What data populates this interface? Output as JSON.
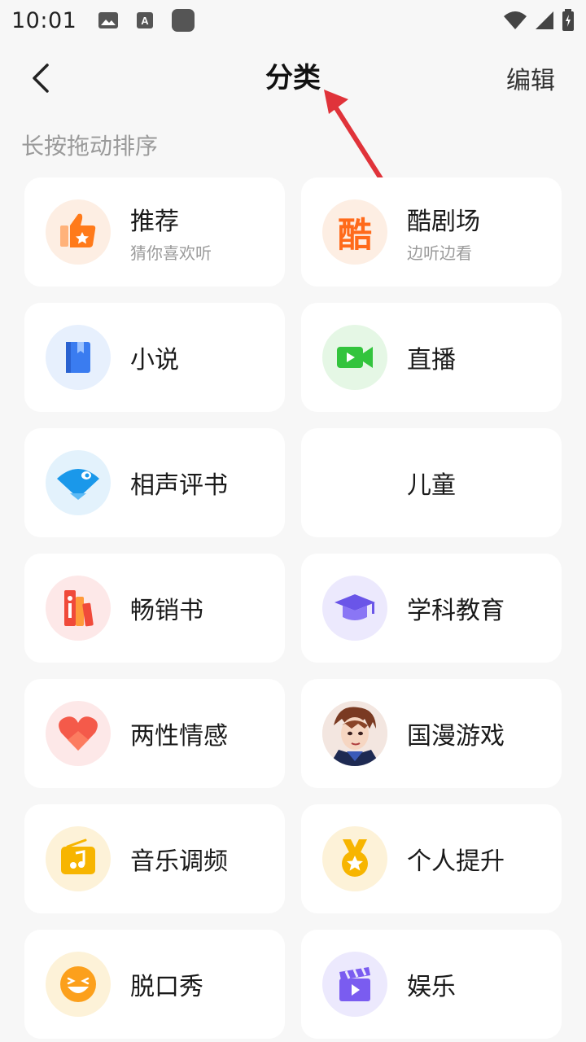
{
  "status": {
    "time": "10:01"
  },
  "header": {
    "title": "分类",
    "edit_label": "编辑"
  },
  "hint": "长按拖动排序",
  "categories": [
    {
      "title": "推荐",
      "subtitle": "猜你喜欢听",
      "icon": "thumbs-up-star-icon",
      "bg": "#fdeee3",
      "color": "#ff7a1a"
    },
    {
      "title": "酷剧场",
      "subtitle": "边听边看",
      "icon": "ku-theater-icon",
      "bg": "#fdeee3",
      "color": "#ff6a1a",
      "glyph": "酷"
    },
    {
      "title": "小说",
      "icon": "book-icon",
      "bg": "#e7f0fd",
      "color": "#3a7cf0"
    },
    {
      "title": "直播",
      "icon": "video-camera-icon",
      "bg": "#e5f7e5",
      "color": "#33c43d"
    },
    {
      "title": "相声评书",
      "icon": "fan-icon",
      "bg": "#e3f2fc",
      "color": "#1a98ea"
    },
    {
      "title": "儿童",
      "icon": "",
      "bg": "",
      "color": ""
    },
    {
      "title": "畅销书",
      "icon": "bestseller-books-icon",
      "bg": "#fde8e8",
      "color": "#f04a3a"
    },
    {
      "title": "学科教育",
      "icon": "graduation-cap-icon",
      "bg": "#ece9fd",
      "color": "#6a55e8"
    },
    {
      "title": "两性情感",
      "icon": "heart-icon",
      "bg": "#fde8e8",
      "color": "#f45a4a"
    },
    {
      "title": "国漫游戏",
      "icon": "anime-character-icon",
      "bg": "#f2e5e0",
      "color": "#3a2a2a"
    },
    {
      "title": "音乐调频",
      "icon": "music-radio-icon",
      "bg": "#fdf2d8",
      "color": "#f7b500"
    },
    {
      "title": "个人提升",
      "icon": "medal-icon",
      "bg": "#fdf2d8",
      "color": "#f7b500"
    },
    {
      "title": "脱口秀",
      "icon": "laughing-face-icon",
      "bg": "#fdf2d8",
      "color": "#fca01c"
    },
    {
      "title": "娱乐",
      "icon": "clapperboard-icon",
      "bg": "#ece9fd",
      "color": "#7a5cf0"
    }
  ],
  "colors": {
    "background": "#f7f7f7",
    "card": "#ffffff",
    "annotation_arrow": "#e0333a"
  }
}
